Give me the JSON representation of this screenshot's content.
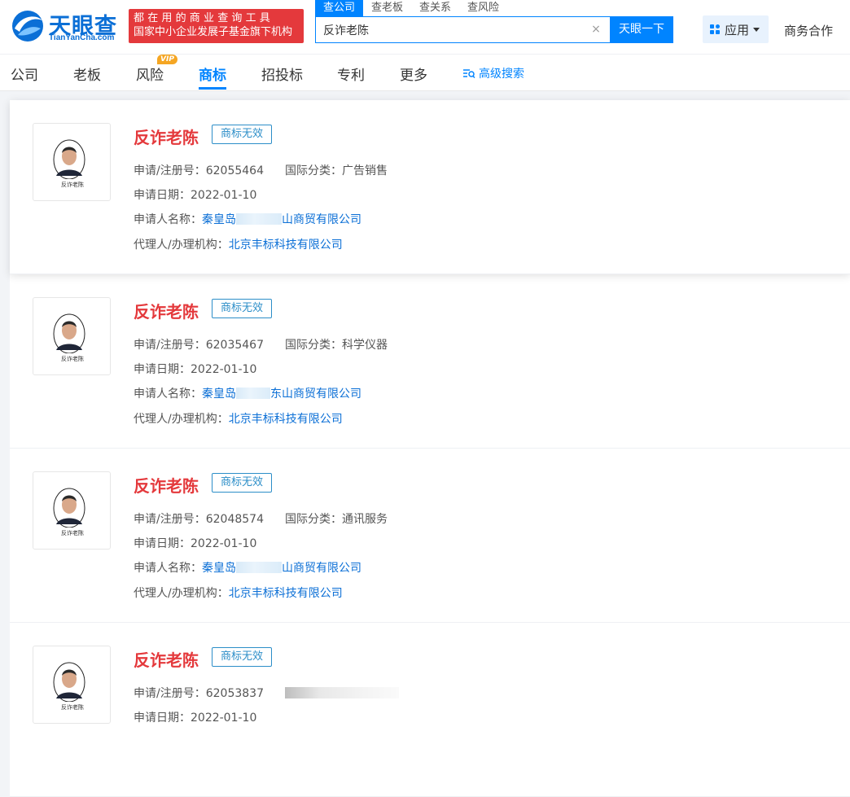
{
  "header": {
    "logo_text": "天眼查",
    "logo_sub": "TianYanCha.com",
    "slogan_line1": "都在用的商业查询工具",
    "slogan_line2": "国家中小企业发展子基金旗下机构",
    "search_tabs": [
      "查公司",
      "查老板",
      "查关系",
      "查风险"
    ],
    "search_value": "反诈老陈",
    "search_button": "天眼一下",
    "app_button": "应用",
    "biz_link": "商务合作"
  },
  "nav": {
    "items": [
      "公司",
      "老板",
      "风险",
      "商标",
      "招投标",
      "专利",
      "更多"
    ],
    "vip": "VIP",
    "advanced_search": "高级搜索"
  },
  "labels": {
    "reg_no": "申请/注册号：",
    "intl_class": "国际分类：",
    "apply_date": "申请日期：",
    "applicant": "申请人名称：",
    "agent": "代理人/办理机构："
  },
  "results": [
    {
      "name": "反诈老陈",
      "thumb_text": "反诈老陈",
      "status": "商标无效",
      "reg_no": "62055464",
      "intl_class": "广告销售",
      "apply_date": "2022-01-10",
      "applicant_prefix": "秦皇岛",
      "applicant_suffix": "山商贸有限公司",
      "agent": "北京丰标科技有限公司"
    },
    {
      "name": "反诈老陈",
      "thumb_text": "反诈老陈",
      "status": "商标无效",
      "reg_no": "62035467",
      "intl_class": "科学仪器",
      "apply_date": "2022-01-10",
      "applicant_prefix": "秦皇岛",
      "applicant_suffix": "东山商贸有限公司",
      "agent": "北京丰标科技有限公司"
    },
    {
      "name": "反诈老陈",
      "thumb_text": "反诈老陈",
      "status": "商标无效",
      "reg_no": "62048574",
      "intl_class": "通讯服务",
      "apply_date": "2022-01-10",
      "applicant_prefix": "秦皇岛",
      "applicant_suffix": "山商贸有限公司",
      "agent": "北京丰标科技有限公司"
    },
    {
      "name": "反诈老陈",
      "thumb_text": "反诈老陈",
      "status": "商标无效",
      "reg_no": "62053837",
      "apply_date": "2022-01-10"
    }
  ]
}
